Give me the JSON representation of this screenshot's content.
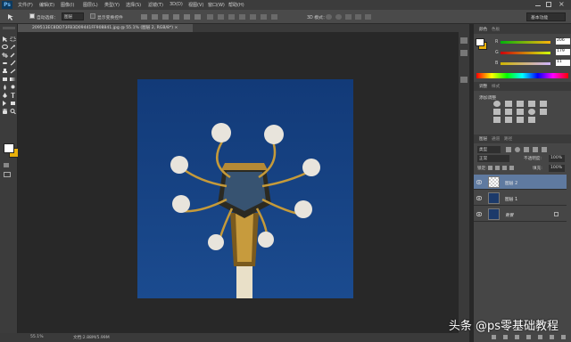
{
  "app": {
    "logo": "Ps"
  },
  "menu": [
    "文件(F)",
    "编辑(E)",
    "图像(I)",
    "图层(L)",
    "类型(Y)",
    "选择(S)",
    "滤镜(T)",
    "3D(D)",
    "视图(V)",
    "窗口(W)",
    "帮助(H)"
  ],
  "options": {
    "auto_select_label": "自动选择：",
    "auto_select_value": "图层",
    "show_transform_label": "显示变换控件",
    "mode_3d_label": "3D 模式：",
    "workspace": "基本功能"
  },
  "document": {
    "tab_title": "209513EC8DD73FB3D09441FF908841.jpg @ 55.1% (图层 2, RGB/8*) ×",
    "status_zoom": "55.1%",
    "status_doc": "文档:2.88M/5.99M"
  },
  "color_panel": {
    "tabs": [
      "颜色",
      "色板"
    ],
    "channels": [
      {
        "label": "R",
        "value": "206"
      },
      {
        "label": "G",
        "value": "179"
      },
      {
        "label": "B",
        "value": "11"
      }
    ],
    "colors": {
      "foreground": "#ffffff",
      "background": "#e8b00b"
    }
  },
  "adjust_panel": {
    "tabs": [
      "调整",
      "样式"
    ],
    "title": "添加调整"
  },
  "layers_panel": {
    "tabs": [
      "图层",
      "通道",
      "路径"
    ],
    "kind_label": "类型",
    "blend_mode": "正常",
    "opacity_label": "不透明度:",
    "opacity_value": "100%",
    "lock_label": "锁定:",
    "fill_label": "填充:",
    "fill_value": "100%",
    "layers": [
      {
        "name": "图层 2",
        "selected": true
      },
      {
        "name": "图层 1",
        "selected": false
      },
      {
        "name": "背景",
        "selected": false
      }
    ]
  },
  "watermark": "头条 @ps零基础教程"
}
